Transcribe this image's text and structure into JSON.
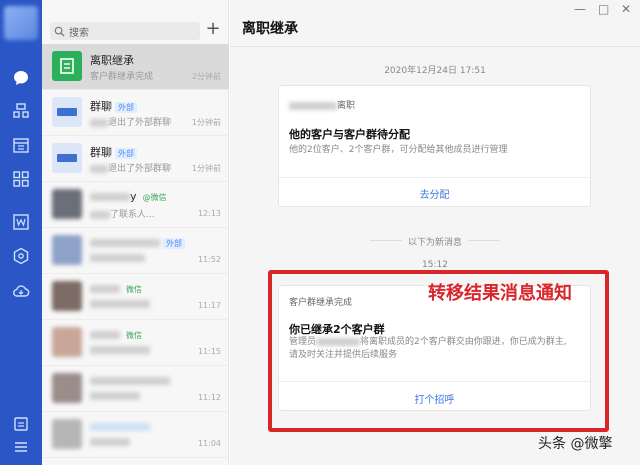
{
  "search": {
    "placeholder": "搜索"
  },
  "conversations": [
    {
      "name": "离职继承",
      "preview": "客户群继承完成",
      "time": "2分钟前"
    },
    {
      "name": "群聊",
      "tag": "外部",
      "preview": "退出了外部群聊",
      "time": "1分钟前"
    },
    {
      "name": "群聊",
      "tag": "外部",
      "preview": "退出了外部群聊",
      "time": "1分钟前"
    },
    {
      "name": "y",
      "tag": "@微信",
      "preview": "了联系人...",
      "time": "12:13"
    },
    {
      "name": "",
      "tag": "外部",
      "preview": "",
      "time": "11:52"
    },
    {
      "name": "",
      "tag": "微信",
      "preview": "",
      "time": "11:17"
    },
    {
      "name": "",
      "tag": "微信",
      "preview": "",
      "time": "11:15"
    },
    {
      "name": "",
      "tag": "",
      "preview": "",
      "time": "11:12"
    },
    {
      "name": "",
      "tag": "",
      "preview": "",
      "time": "11:04"
    }
  ],
  "main": {
    "title": "离职继承",
    "date": "2020年12月24日 17:51",
    "card1": {
      "header": "离职",
      "heading": "他的客户与客户群待分配",
      "desc": "他的2位客户、2个客户群，可分配给其他成员进行管理",
      "action": "去分配"
    },
    "new_messages": "以下为新消息",
    "time2": "15:12",
    "card2": {
      "header": "客户群继承完成",
      "heading": "你已继承2个客户群",
      "desc1": "管理员",
      "desc1b": "将离职成员的2个客户群交由你跟进，你已成为群主,",
      "desc2": "请及时关注并提供后续服务",
      "action": "打个招呼"
    },
    "annotation": "转移结果消息通知",
    "watermark": "头条 @微擎"
  },
  "colors": {
    "rail": "#2a56c6",
    "accent": "#3b78e7",
    "annotation": "#d9262b",
    "listBg": "#f7f7f7"
  },
  "icons": [
    "chat-icon",
    "contacts-icon",
    "calendar-icon",
    "apps-icon",
    "doc-icon",
    "cube-icon",
    "cloud-icon",
    "settings-icon",
    "menu-icon",
    "search-icon"
  ]
}
